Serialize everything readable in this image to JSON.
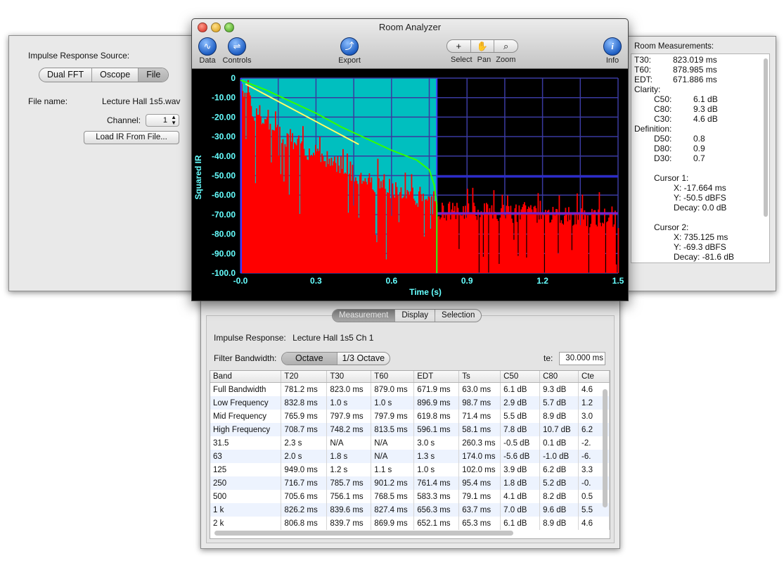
{
  "window": {
    "title": "Room Analyzer",
    "toolbar": {
      "data_label": "Data",
      "controls_label": "Controls",
      "export_label": "Export",
      "select_label": "Select",
      "pan_label": "Pan",
      "zoom_label": "Zoom",
      "info_label": "Info"
    }
  },
  "source_panel": {
    "heading": "Impulse Response Source:",
    "modes": [
      "Dual FFT",
      "Oscope",
      "File"
    ],
    "selected_mode": "File",
    "file_name_label": "File name:",
    "file_name_value": "Lecture Hall 1s5.wav",
    "channel_label": "Channel:",
    "channel_value": "1",
    "load_button": "Load IR From File..."
  },
  "measurements": {
    "title": "Room Measurements:",
    "t30_label": "T30:",
    "t30_value": "823.019 ms",
    "t60_label": "T60:",
    "t60_value": "878.985 ms",
    "edt_label": "EDT:",
    "edt_value": "671.886 ms",
    "clarity_label": "Clarity:",
    "c50_label": "C50:",
    "c50_value": "6.1 dB",
    "c80_label": "C80:",
    "c80_value": "9.3 dB",
    "c30_label": "C30:",
    "c30_value": "4.6 dB",
    "definition_label": "Definition:",
    "d50_label": "D50:",
    "d50_value": "0.8",
    "d80_label": "D80:",
    "d80_value": "0.9",
    "d30_label": "D30:",
    "d30_value": "0.7",
    "cursor1_label": "Cursor 1:",
    "cursor1_x": "X: -17.664 ms",
    "cursor1_y": "Y: -50.5 dBFS",
    "cursor1_decay": "Decay: 0.0 dB",
    "cursor2_label": "Cursor 2:",
    "cursor2_x": "X: 735.125 ms",
    "cursor2_y": "Y: -69.3 dBFS",
    "cursor2_decay": "Decay: -81.6 dB"
  },
  "bottom_panel": {
    "tabs": [
      "Measurement",
      "Display",
      "Selection"
    ],
    "selected_tab": "Measurement",
    "impulse_label": "Impulse Response:",
    "impulse_value": "Lecture Hall 1s5 Ch 1",
    "filter_label": "Filter Bandwidth:",
    "filter_options": [
      "Octave",
      "1/3 Octave"
    ],
    "filter_selected": "Octave",
    "te_label": "te:",
    "te_value": "30.000 ms",
    "table": {
      "columns": [
        "Band",
        "T20",
        "T30",
        "T60",
        "EDT",
        "Ts",
        "C50",
        "C80",
        "Cte"
      ],
      "rows": [
        [
          "Full Bandwidth",
          "781.2 ms",
          "823.0 ms",
          "879.0 ms",
          "671.9 ms",
          "63.0 ms",
          "6.1 dB",
          "9.3 dB",
          "4.6"
        ],
        [
          "Low Frequency",
          "832.8 ms",
          "1.0 s",
          "1.0 s",
          "896.9 ms",
          "98.7 ms",
          "2.9 dB",
          "5.7 dB",
          "1.2"
        ],
        [
          "Mid Frequency",
          "765.9 ms",
          "797.9 ms",
          "797.9 ms",
          "619.8 ms",
          "71.4 ms",
          "5.5 dB",
          "8.9 dB",
          "3.0"
        ],
        [
          "High Frequency",
          "708.7 ms",
          "748.2 ms",
          "813.5 ms",
          "596.1 ms",
          "58.1 ms",
          "7.8 dB",
          "10.7 dB",
          "6.2"
        ],
        [
          "31.5",
          "2.3 s",
          "N/A",
          "N/A",
          "3.0 s",
          "260.3 ms",
          "-0.5 dB",
          "0.1 dB",
          "-2."
        ],
        [
          "63",
          "2.0 s",
          "1.8 s",
          "N/A",
          "1.3 s",
          "174.0 ms",
          "-5.6 dB",
          "-1.0 dB",
          "-6."
        ],
        [
          "125",
          "949.0 ms",
          "1.2 s",
          "1.1 s",
          "1.0 s",
          "102.0 ms",
          "3.9 dB",
          "6.2 dB",
          "3.3"
        ],
        [
          "250",
          "716.7 ms",
          "785.7 ms",
          "901.2 ms",
          "761.4 ms",
          "95.4 ms",
          "1.8 dB",
          "5.2 dB",
          "-0."
        ],
        [
          "500",
          "705.6 ms",
          "756.1 ms",
          "768.5 ms",
          "583.3 ms",
          "79.1 ms",
          "4.1 dB",
          "8.2 dB",
          "0.5"
        ],
        [
          "1 k",
          "826.2 ms",
          "839.6 ms",
          "827.4 ms",
          "656.3 ms",
          "63.7 ms",
          "7.0 dB",
          "9.6 dB",
          "5.5"
        ],
        [
          "2 k",
          "806.8 ms",
          "839.7 ms",
          "869.9 ms",
          "652.1 ms",
          "65.3 ms",
          "6.1 dB",
          "8.9 dB",
          "4.6"
        ]
      ]
    }
  },
  "chart_data": {
    "type": "area",
    "xlabel": "Time (s)",
    "ylabel": "Squared IR",
    "xlim": [
      0.0,
      1.5
    ],
    "ylim": [
      -100.0,
      0
    ],
    "x_ticks": [
      "-0.0",
      "0.3",
      "0.6",
      "0.9",
      "1.2",
      "1.5"
    ],
    "y_ticks": [
      "0",
      "-10.00",
      "-20.00",
      "-30.00",
      "-40.00",
      "-50.00",
      "-60.00",
      "-70.00",
      "-80.00",
      "-90.00",
      "-100.0"
    ],
    "selection_range": [
      0.0,
      0.78
    ],
    "cursor_levels": [
      -50.5,
      -69.3
    ],
    "colors": {
      "selection": "#00bfbf",
      "ir": "#ff0000",
      "decay": "#33ff00",
      "fit": "#ffff66",
      "grid": "#3a3aa0",
      "axis_text": "#66ffff"
    },
    "decay_curve": {
      "x": [
        0.0,
        0.1,
        0.2,
        0.3,
        0.4,
        0.5,
        0.6,
        0.7,
        0.75,
        0.77,
        0.78,
        0.78
      ],
      "y": [
        -1,
        -6,
        -12,
        -18,
        -25,
        -31,
        -37,
        -42,
        -47,
        -55,
        -65,
        -100
      ]
    },
    "fit_line": {
      "x": [
        0.02,
        0.47
      ],
      "y": [
        -3,
        -34
      ]
    },
    "ir_envelope": {
      "x": [
        0.0,
        0.02,
        0.05,
        0.1,
        0.2,
        0.3,
        0.4,
        0.5,
        0.6,
        0.7,
        0.8,
        1.0,
        1.2,
        1.5
      ],
      "y": [
        -2,
        -8,
        -18,
        -24,
        -32,
        -40,
        -45,
        -52,
        -57,
        -62,
        -68,
        -69,
        -70,
        -73
      ]
    }
  }
}
